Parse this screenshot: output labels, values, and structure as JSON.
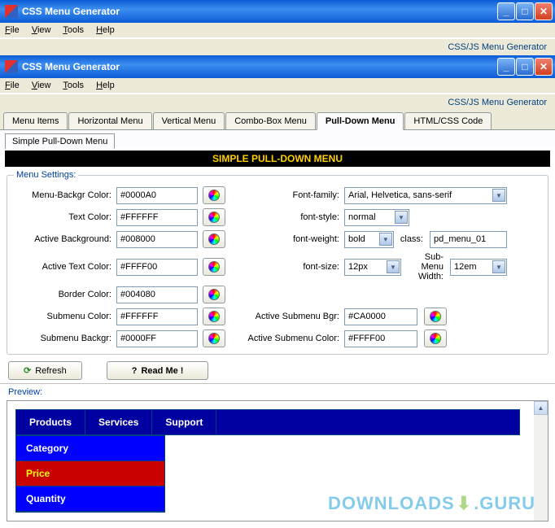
{
  "window1": {
    "title": "CSS Menu Generator",
    "menu": [
      "File",
      "View",
      "Tools",
      "Help"
    ],
    "tagline": "CSS/JS Menu Generator"
  },
  "window2": {
    "title": "CSS Menu Generator",
    "menu": [
      "File",
      "View",
      "Tools",
      "Help"
    ],
    "tagline": "CSS/JS Menu Generator"
  },
  "tabs": [
    "Menu Items",
    "Horizontal Menu",
    "Vertical Menu",
    "Combo-Box Menu",
    "Pull-Down Menu",
    "HTML/CSS Code"
  ],
  "active_tab": "Pull-Down Menu",
  "subtab": "Simple Pull-Down Menu",
  "banner": "SIMPLE PULL-DOWN MENU",
  "settings_legend": "Menu Settings:",
  "labels": {
    "menu_bg": "Menu-Backgr Color:",
    "text": "Text Color:",
    "active_bg": "Active Background:",
    "active_text": "Active Text Color:",
    "border": "Border Color:",
    "submenu_color": "Submenu Color:",
    "submenu_bg": "Submenu Backgr:",
    "font_family": "Font-family:",
    "font_style": "font-style:",
    "font_weight": "font-weight:",
    "font_size": "font-size:",
    "class": "class:",
    "submenu_width": "Sub-Menu Width:",
    "active_sub_bg": "Active Submenu Bgr:",
    "active_sub_color": "Active Submenu Color:"
  },
  "values": {
    "menu_bg": "#0000A0",
    "text": "#FFFFFF",
    "active_bg": "#008000",
    "active_text": "#FFFF00",
    "border": "#004080",
    "submenu_color": "#FFFFFF",
    "submenu_bg": "#0000FF",
    "font_family": "Arial, Helvetica, sans-serif",
    "font_style": "normal",
    "font_weight": "bold",
    "font_size": "12px",
    "class": "pd_menu_01",
    "submenu_width": "12em",
    "active_sub_bg": "#CA0000",
    "active_sub_color": "#FFFF00"
  },
  "buttons": {
    "refresh": "Refresh",
    "readme": "Read Me !"
  },
  "preview_label": "Preview:",
  "preview_menu": [
    "Products",
    "Services",
    "Support"
  ],
  "preview_submenu": [
    "Category",
    "Price",
    "Quantity"
  ],
  "watermark": {
    "a": "DOWNLOADS",
    "b": ".GURU"
  }
}
